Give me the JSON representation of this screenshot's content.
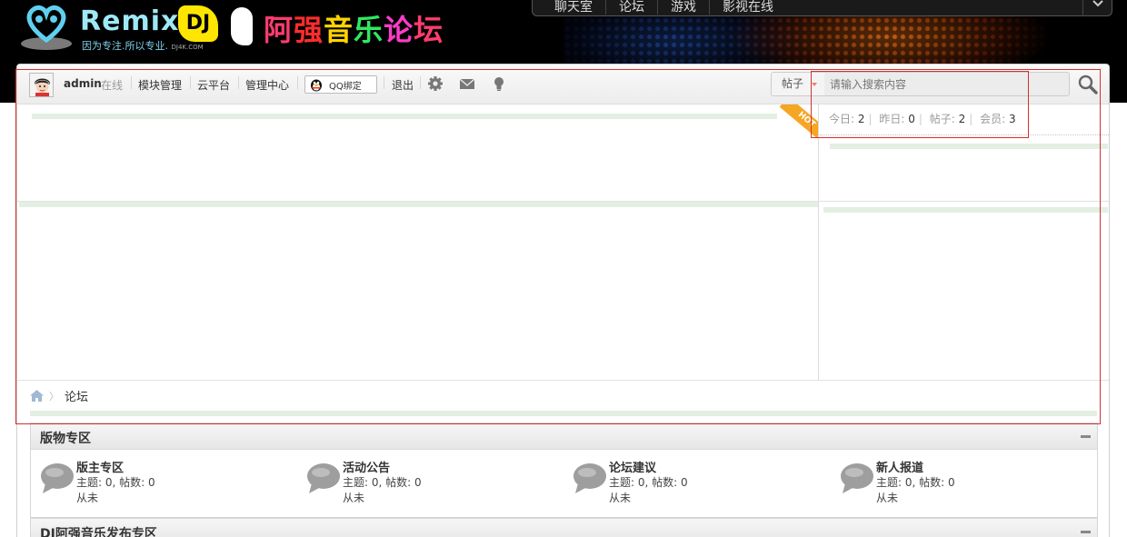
{
  "banner": {
    "logo_text": "Remix.",
    "logo_slogan": "因为专注.所以专业.",
    "logo_domain": "DJ4K.COM",
    "logo_dj": "DJ",
    "logo_cn": [
      "阿",
      "强",
      "音",
      "乐",
      "论",
      "坛"
    ],
    "nav": [
      "聊天室",
      "论坛",
      "游戏",
      "影视在线"
    ]
  },
  "toolbar": {
    "username": "admin",
    "status": "在线",
    "links": [
      "模块管理",
      "云平台",
      "管理中心"
    ],
    "qq_bind": "QQ绑定",
    "logout": "退出"
  },
  "search": {
    "type_label": "帖子",
    "placeholder": "请输入搜索内容"
  },
  "hot_label": "HOT",
  "stats": {
    "today_label": "今日:",
    "today": "2",
    "yesterday_label": "昨日:",
    "yesterday": "0",
    "posts_label": "帖子:",
    "posts": "2",
    "members_label": "会员:",
    "members": "3"
  },
  "breadcrumb": {
    "current": "论坛"
  },
  "categories": [
    {
      "title": "版物专区",
      "forums": [
        {
          "name": "版主专区",
          "meta": "主题: 0, 帖数: 0",
          "last": "从未"
        },
        {
          "name": "活动公告",
          "meta": "主题: 0, 帖数: 0",
          "last": "从未"
        },
        {
          "name": "论坛建议",
          "meta": "主题: 0, 帖数: 0",
          "last": "从未"
        },
        {
          "name": "新人报道",
          "meta": "主题: 0, 帖数: 0",
          "last": "从未"
        }
      ]
    },
    {
      "title": "DJ阿强音乐发布专区"
    }
  ],
  "colors": {
    "banner_bg": "#000000",
    "highlight_bar": "#e2efe2",
    "hot_ribbon": "#f5a623",
    "annotation_box": "#d43030"
  },
  "icons": {
    "search": "magnifier-icon",
    "settings": "gear-icon",
    "message": "envelope-icon",
    "notice": "lightbulb-icon",
    "home": "home-icon",
    "forum": "speech-bubble-icon",
    "qq": "penguin-icon"
  }
}
